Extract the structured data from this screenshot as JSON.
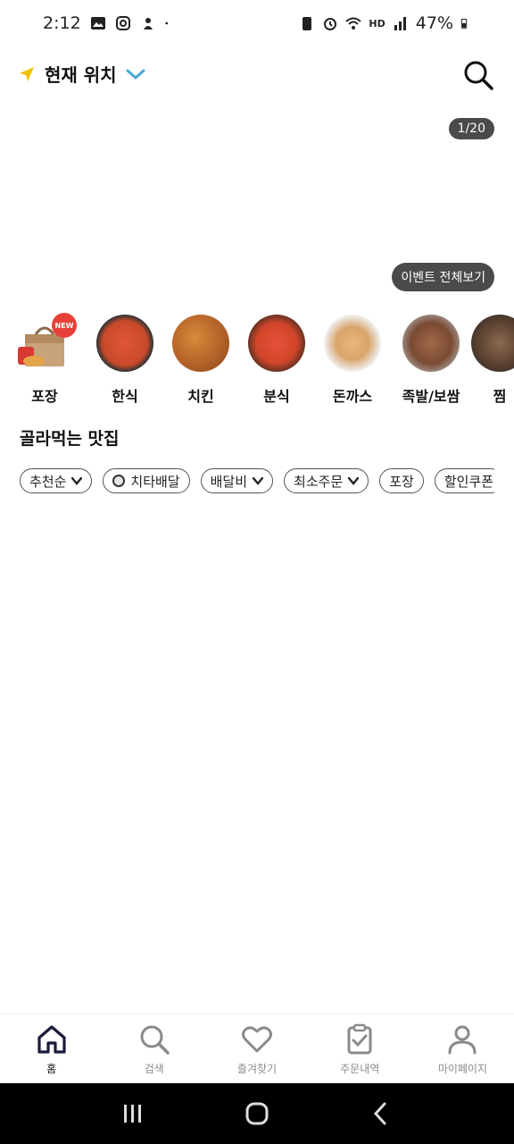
{
  "status_bar": {
    "time": "2:12",
    "battery": "47%",
    "hd_label": "HD"
  },
  "header": {
    "location_label": "현재 위치"
  },
  "banner": {
    "page_counter": "1/20",
    "event_all_label": "이벤트 전체보기"
  },
  "categories": [
    {
      "label": "포장",
      "badge": "NEW",
      "color": "#f5c6b0"
    },
    {
      "label": "한식",
      "color": "#c84a2a"
    },
    {
      "label": "치킨",
      "color": "#b8652a"
    },
    {
      "label": "분식",
      "color": "#d0452a"
    },
    {
      "label": "돈까스",
      "color": "#d9a46a"
    },
    {
      "label": "족발/보쌈",
      "color": "#7a4a32"
    },
    {
      "label": "찜",
      "color": "#5a4030"
    }
  ],
  "section": {
    "title": "골라먹는 맛집"
  },
  "filters": [
    {
      "label": "추천순",
      "dropdown": true
    },
    {
      "label": "치타배달",
      "icon": "cheetah-icon"
    },
    {
      "label": "배달비",
      "dropdown": true
    },
    {
      "label": "최소주문",
      "dropdown": true
    },
    {
      "label": "포장"
    },
    {
      "label": "할인쿠폰"
    }
  ],
  "bottom_nav": [
    {
      "label": "홈",
      "icon": "home-icon",
      "active": true
    },
    {
      "label": "검색",
      "icon": "search-icon"
    },
    {
      "label": "즐겨찾기",
      "icon": "heart-icon"
    },
    {
      "label": "주문내역",
      "icon": "clipboard-check-icon"
    },
    {
      "label": "마이페이지",
      "icon": "person-icon"
    }
  ],
  "colors": {
    "accent_chevron": "#4aa8d8",
    "pill_bg": "#4a4a4a",
    "location_arrow": "#f2c200"
  }
}
